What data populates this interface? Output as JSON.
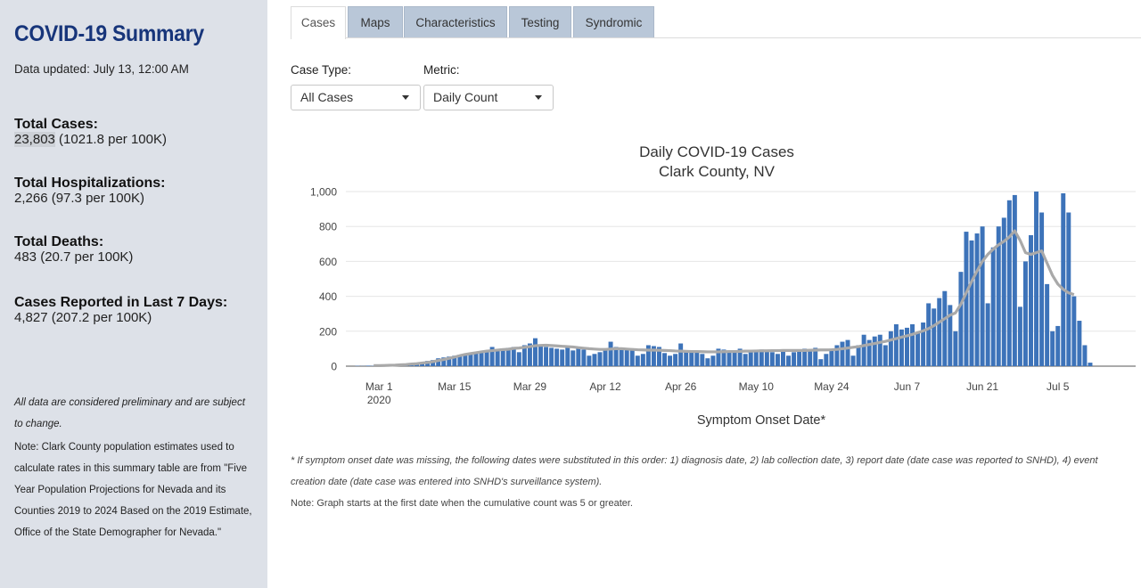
{
  "sidebar": {
    "title": "COVID-19 Summary",
    "updated": "Data updated: July 13, 12:00 AM",
    "stats": [
      {
        "label": "Total Cases:",
        "number": "23,803",
        "rest": " (1021.8 per 100K)"
      },
      {
        "label": "Total Hospitalizations:",
        "number": "2,266",
        "rest": " (97.3 per 100K)"
      },
      {
        "label": "Total Deaths:",
        "number": "483",
        "rest": " (20.7 per 100K)"
      },
      {
        "label": "Cases Reported in Last 7 Days:",
        "number": "4,827",
        "rest": " (207.2 per 100K)"
      }
    ],
    "prelim_note": "All data are considered preliminary and are subject to change.",
    "population_note": "Note: Clark County population estimates used to calculate rates in this summary table are from \"Five Year Population Projections for Nevada and its Counties 2019 to 2024 Based on the 2019 Estimate, Office of the State Demographer for Nevada.\""
  },
  "tabs": [
    "Cases",
    "Maps",
    "Characteristics",
    "Testing",
    "Syndromic"
  ],
  "active_tab": "Cases",
  "controls": {
    "case_type_label": "Case Type:",
    "case_type_value": "All Cases",
    "metric_label": "Metric:",
    "metric_value": "Daily Count"
  },
  "footnotes": {
    "substitution": "* If symptom onset date was missing, the following dates were substituted in this order: 1) diagnosis date, 2) lab collection date, 3) report date (date case was reported to SNHD), 4) event creation date (date case was entered into SNHD's surveillance system).",
    "start": "Note: Graph starts at the first date when the cumulative count was 5 or greater."
  },
  "colors": {
    "bar": "#3d73b9",
    "average_line": "#a9a9a9",
    "sidebar_bg": "#dde1e8",
    "title": "#17357a",
    "tab_inactive": "#b9c7d8"
  },
  "chart_data": {
    "type": "bar",
    "title": [
      "Daily COVID-19 Cases",
      "Clark County, NV"
    ],
    "xlabel": "Symptom Onset Date*",
    "ylabel": "",
    "ylim": [
      0,
      1000
    ],
    "yticks": [
      0,
      200,
      400,
      600,
      800,
      1000
    ],
    "ytick_labels": [
      "0",
      "200",
      "400",
      "600",
      "800",
      "1,000"
    ],
    "start_date": "2020-02-26",
    "x_tick_dates": [
      "2020-03-01",
      "2020-03-15",
      "2020-03-29",
      "2020-04-12",
      "2020-04-26",
      "2020-05-10",
      "2020-05-24",
      "2020-06-07",
      "2020-06-21",
      "2020-07-05"
    ],
    "x_tick_labels": [
      "Mar 1",
      "Mar 15",
      "Mar 29",
      "Apr 12",
      "Apr 26",
      "May 10",
      "May 24",
      "Jun 7",
      "Jun 21",
      "Jul 5"
    ],
    "x_tick_sublabel": "2020",
    "grid": true,
    "series": [
      {
        "kind": "bar",
        "values": [
          2,
          1,
          3,
          2,
          5,
          4,
          7,
          8,
          10,
          12,
          15,
          18,
          20,
          30,
          35,
          45,
          50,
          55,
          60,
          65,
          70,
          75,
          80,
          85,
          90,
          110,
          90,
          100,
          105,
          110,
          80,
          120,
          130,
          160,
          120,
          110,
          105,
          100,
          95,
          110,
          90,
          105,
          95,
          60,
          70,
          80,
          90,
          140,
          110,
          100,
          100,
          90,
          60,
          70,
          120,
          115,
          110,
          75,
          60,
          70,
          130,
          90,
          85,
          80,
          70,
          45,
          60,
          100,
          95,
          80,
          90,
          100,
          70,
          80,
          90,
          95,
          90,
          80,
          70,
          95,
          60,
          80,
          90,
          100,
          95,
          105,
          40,
          70,
          100,
          120,
          140,
          150,
          60,
          120,
          180,
          150,
          170,
          180,
          120,
          200,
          240,
          210,
          220,
          240,
          190,
          250,
          360,
          330,
          390,
          430,
          350,
          200,
          540,
          770,
          720,
          760,
          800,
          360,
          680,
          800,
          850,
          950,
          980,
          340,
          600,
          750,
          1000,
          880,
          470,
          200,
          230,
          990,
          880,
          400,
          260,
          120,
          20
        ]
      },
      {
        "kind": "line",
        "values": [
          null,
          null,
          null,
          3,
          3,
          4,
          5,
          6,
          8,
          9,
          12,
          14,
          18,
          21,
          26,
          32,
          38,
          45,
          52,
          60,
          67,
          72,
          77,
          82,
          86,
          89,
          92,
          95,
          97,
          102,
          104,
          108,
          112,
          117,
          119,
          120,
          118,
          116,
          114,
          112,
          110,
          106,
          103,
          100,
          98,
          96,
          96,
          98,
          100,
          100,
          98,
          96,
          94,
          93,
          92,
          92,
          91,
          90,
          89,
          87,
          86,
          85,
          84,
          84,
          83,
          82,
          82,
          82,
          83,
          84,
          84,
          85,
          86,
          86,
          87,
          88,
          88,
          89,
          89,
          90,
          90,
          90,
          90,
          90,
          91,
          92,
          93,
          93,
          94,
          96,
          100,
          104,
          108,
          112,
          118,
          124,
          130,
          136,
          142,
          150,
          158,
          166,
          174,
          182,
          192,
          202,
          215,
          232,
          252,
          272,
          292,
          305,
          355,
          420,
          485,
          545,
          600,
          640,
          670,
          695,
          715,
          740,
          775,
          720,
          650,
          640,
          650,
          660,
          590,
          520,
          470,
          440,
          420,
          410,
          null,
          null,
          null
        ]
      }
    ]
  }
}
